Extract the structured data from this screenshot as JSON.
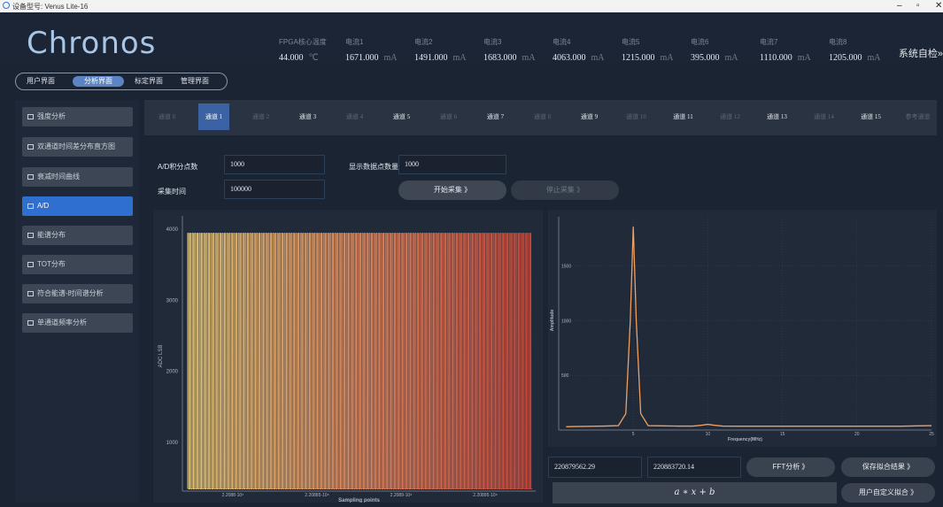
{
  "window": {
    "title": "设备型号: Venus Lite-16",
    "controls": [
      "–",
      "▫",
      "✕"
    ]
  },
  "header": {
    "logo": "Chronos",
    "metrics": [
      {
        "label": "FPGA核心温度",
        "value": "44.000",
        "unit": "℃"
      },
      {
        "label": "电流1",
        "value": "1671.000",
        "unit": "mA"
      },
      {
        "label": "电流2",
        "value": "1491.000",
        "unit": "mA"
      },
      {
        "label": "电流3",
        "value": "1683.000",
        "unit": "mA"
      },
      {
        "label": "电流4",
        "value": "4063.000",
        "unit": "mA"
      },
      {
        "label": "电流5",
        "value": "1215.000",
        "unit": "mA"
      },
      {
        "label": "电流6",
        "value": "395.000",
        "unit": "mA"
      },
      {
        "label": "电流7",
        "value": "1110.000",
        "unit": "mA"
      },
      {
        "label": "电流8",
        "value": "1205.000",
        "unit": "mA"
      }
    ],
    "self_test": "系统自检»"
  },
  "top_tabs": [
    "用户界面",
    "分析界面",
    "标定界面",
    "管理界面"
  ],
  "top_tabs_active": 1,
  "sidebar": {
    "items": [
      "强度分析",
      "双通道时间差分布直方图",
      "衰减时间曲线",
      "A/D",
      "能谱分布",
      "TOT分布",
      "符合能谱-时间谱分析",
      "单通道频率分析"
    ],
    "active": 3
  },
  "channels": {
    "items": [
      "通道 0",
      "通道 1",
      "通道 2",
      "通道 3",
      "通道 4",
      "通道 5",
      "通道 6",
      "通道 7",
      "通道 8",
      "通道 9",
      "通道 10",
      "通道 11",
      "通道 12",
      "通道 13",
      "通道 14",
      "通道 15",
      "参考通道"
    ],
    "active": 1,
    "bright": [
      1,
      3,
      5,
      7,
      9,
      11,
      13,
      15
    ]
  },
  "params": {
    "ad_points_label": "A/D积分点数",
    "ad_points_value": "1000",
    "display_points_label": "显示数据点数量",
    "display_points_value": "1000",
    "sample_time_label": "采集时间",
    "sample_time_value": "100000",
    "start_button": "开始采集 》",
    "stop_button": "停止采集 》"
  },
  "left_chart": {
    "ylabel": "ADC LSB",
    "xlabel": "Sampling points",
    "yticks": [
      "4000",
      "3000",
      "2000",
      "1000"
    ],
    "xticks": [
      "2.2088·10⁸",
      "2.20885·10⁸",
      "2.2089·10⁸",
      "2.20895·10⁸"
    ]
  },
  "right_chart": {
    "ylabel": "Amplitude",
    "xlabel": "Frequency(MHz)",
    "yticks": [
      "1500",
      "1000",
      "500"
    ],
    "xticks": [
      "5",
      "10",
      "15",
      "20",
      "25"
    ]
  },
  "chart_data": [
    {
      "type": "line",
      "title": "",
      "xlabel": "Sampling points",
      "ylabel": "ADC LSB",
      "xlim": [
        220877000,
        220898000
      ],
      "ylim": [
        300,
        4100
      ],
      "signal": {
        "low": 330,
        "high": 3930,
        "pulses": 150
      },
      "grid": false
    },
    {
      "type": "line",
      "title": "",
      "xlabel": "Frequency(MHz)",
      "ylabel": "Amplitude",
      "xlim": [
        0,
        25
      ],
      "ylim": [
        0,
        1950
      ],
      "x": [
        0.5,
        1,
        2,
        3,
        4,
        4.5,
        4.8,
        5,
        5.2,
        5.5,
        6,
        7,
        8,
        9,
        9.6,
        10,
        10.4,
        11,
        12,
        13,
        14,
        15,
        16,
        17,
        18,
        19,
        20,
        21,
        22,
        23,
        24,
        25
      ],
      "y": [
        30,
        32,
        34,
        36,
        40,
        150,
        1000,
        1860,
        1000,
        150,
        40,
        38,
        36,
        36,
        44,
        52,
        44,
        36,
        35,
        35,
        35,
        35,
        35,
        35,
        35,
        35,
        35,
        35,
        35,
        35,
        38,
        40
      ],
      "grid": true
    }
  ],
  "bottom": {
    "field1": "220879562.29",
    "field2": "220883720.14",
    "fft_button": "FFT分析 》",
    "save_fit_button": "保存拟合结果 》",
    "formula": "a ∗ x + b",
    "custom_fit_button": "用户自定义拟合 》"
  },
  "colors": {
    "accent": "#2f6fd0",
    "signal": "#f08a5d",
    "fft": "#f0a060"
  }
}
